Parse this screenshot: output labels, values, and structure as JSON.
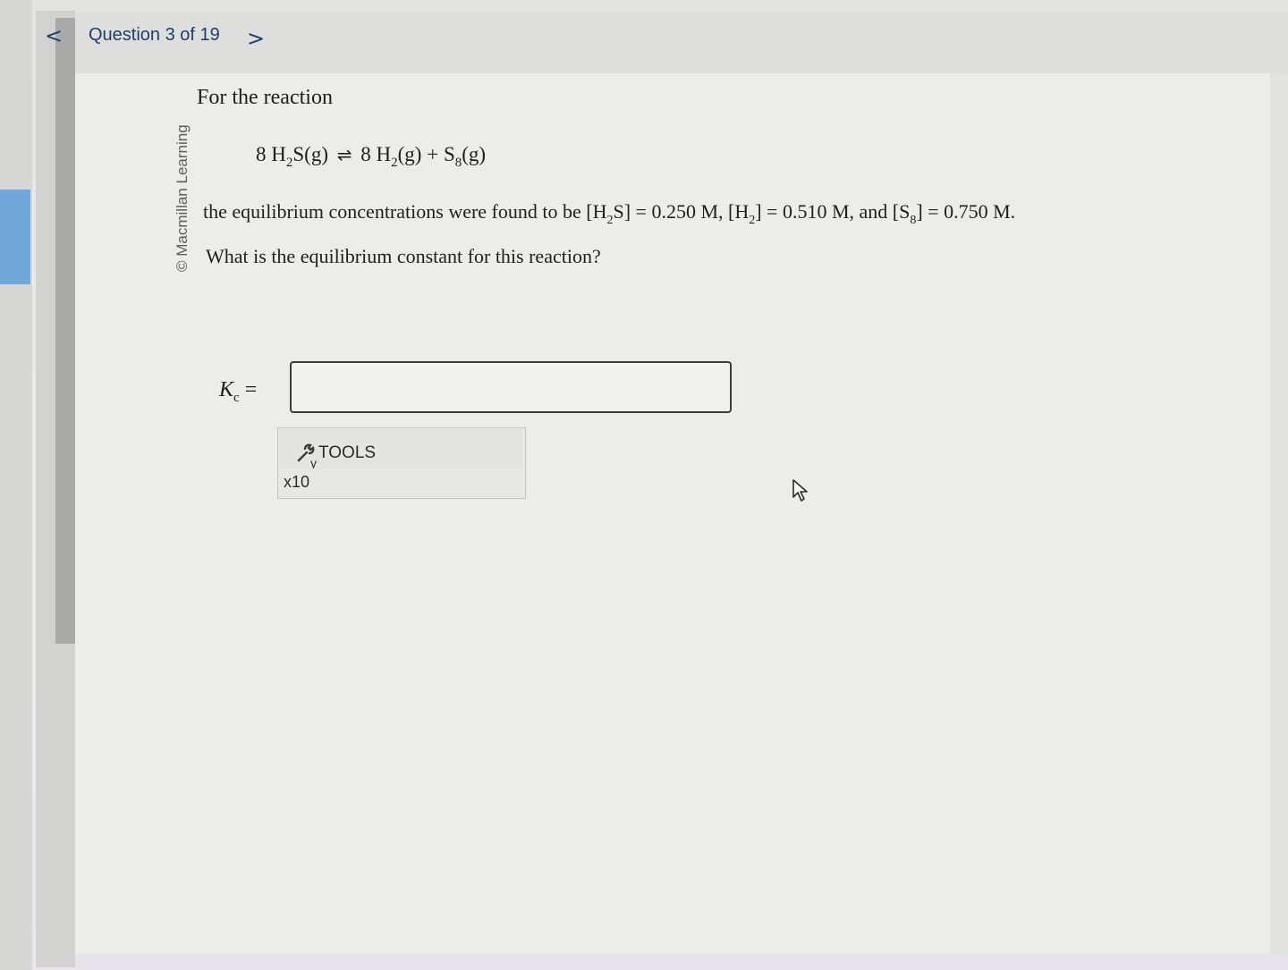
{
  "header": {
    "prev_icon": "chevron-left-icon",
    "prev_glyph": "<",
    "question_label": "Question 3 of 19",
    "next_icon": "chevron-right-icon",
    "next_glyph": ">"
  },
  "copyright": "© Macmillan Learning",
  "problem": {
    "intro": "For the reaction",
    "equation": {
      "lhs_coef": "8",
      "lhs_species": "H",
      "lhs_sub": "2",
      "lhs_rest": "S(g)",
      "arrow": "⇌",
      "rhs1_coef": "8",
      "rhs1_species": "H",
      "rhs1_sub": "2",
      "rhs1_rest": "(g)",
      "plus": "+",
      "rhs2_species": "S",
      "rhs2_sub": "8",
      "rhs2_rest": "(g)"
    },
    "concentrations": {
      "prefix": "the equilibrium concentrations were found to be [H",
      "h2s_sub": "2",
      "h2s_rest": "S] = 0.250 M, [H",
      "h2_sub": "2",
      "h2_rest": "] = 0.510 M, and [S",
      "s8_sub": "8",
      "s8_rest": "] = 0.750 M."
    },
    "question": "What is the equilibrium constant for this reaction?"
  },
  "answer": {
    "label_k": "K",
    "label_sub": "c",
    "label_eq": "=",
    "value": "",
    "placeholder": ""
  },
  "tools": {
    "icon": "wrench-icon",
    "label": "TOOLS",
    "x10_label": "x10"
  },
  "cursor_icon": "mouse-pointer-icon",
  "colors": {
    "nav_text": "#1d3f6b",
    "left_accent": "#6fa8d9"
  }
}
